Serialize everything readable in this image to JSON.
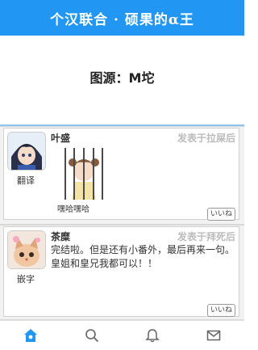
{
  "header": {
    "title": "个汉联合 · 硕果的α王"
  },
  "source": {
    "text": "图源：M坨"
  },
  "posts": [
    {
      "author": "叶盛",
      "posted": "发表于拉屎后",
      "avatar_label": "翻译",
      "sticker_caption": "嘿哈嘿哈",
      "like": "いいね"
    },
    {
      "author": "茶糜",
      "posted": "发表于拜死后",
      "avatar_label": "嵌字",
      "message": "完结啦。但是还有小番外，最后再来一句。皇姐和皇兄我都可以！！",
      "like": "いいね"
    }
  ],
  "tabs": [
    {
      "icon": "home-icon",
      "active": true
    },
    {
      "icon": "search-icon",
      "active": false
    },
    {
      "icon": "bell-icon",
      "active": false
    },
    {
      "icon": "mail-icon",
      "active": false
    }
  ],
  "colors": {
    "accent": "#2196f3",
    "posted_gray": "#bbbbbb"
  }
}
